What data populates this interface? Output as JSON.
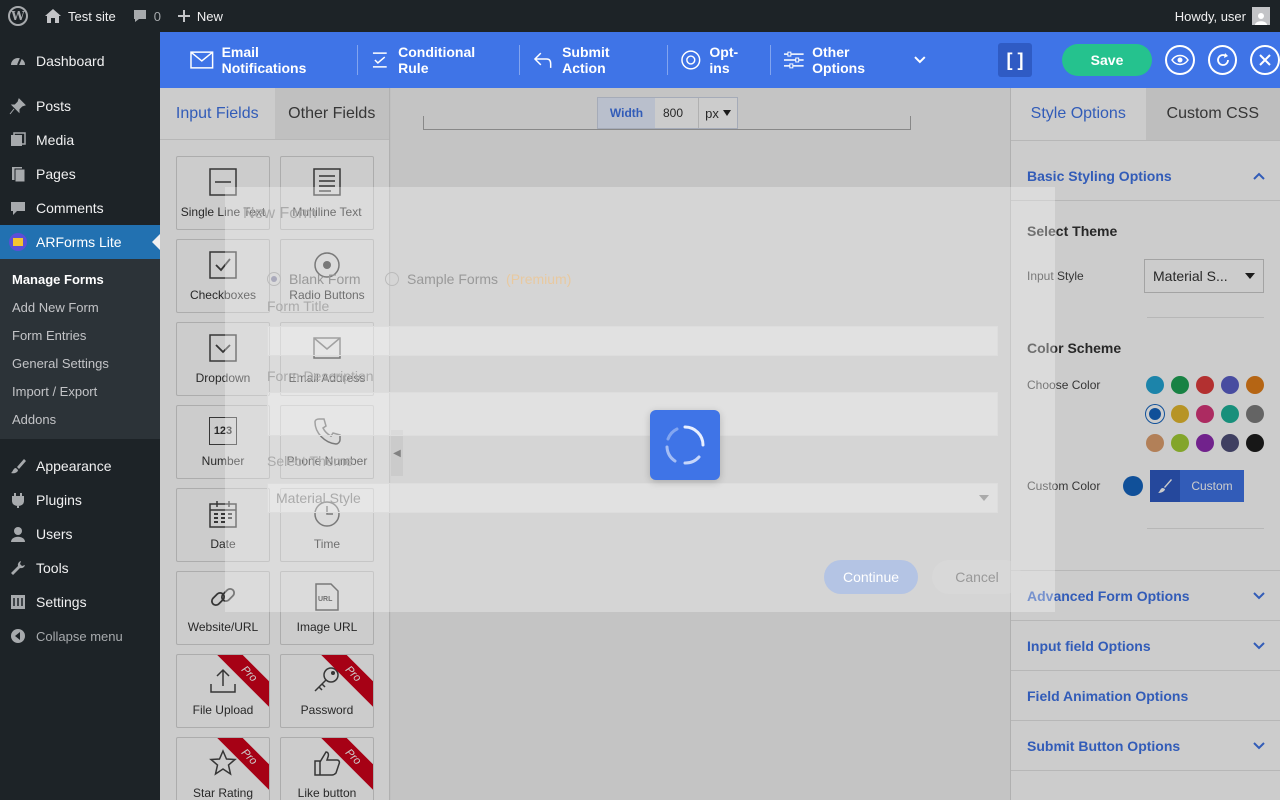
{
  "admin_bar": {
    "site_name": "Test site",
    "comments_count": "0",
    "new_label": "New",
    "howdy": "Howdy, user"
  },
  "sidebar": {
    "items": [
      {
        "label": "Dashboard",
        "icon": "dashboard-icon"
      },
      {
        "label": "Posts",
        "icon": "pin-icon"
      },
      {
        "label": "Media",
        "icon": "media-icon"
      },
      {
        "label": "Pages",
        "icon": "pages-icon"
      },
      {
        "label": "Comments",
        "icon": "comment-icon"
      },
      {
        "label": "ARForms Lite",
        "icon": "arforms-icon"
      }
    ],
    "submenu": [
      "Manage Forms",
      "Add New Form",
      "Form Entries",
      "General Settings",
      "Import / Export",
      "Addons"
    ],
    "items2": [
      {
        "label": "Appearance",
        "icon": "brush-icon"
      },
      {
        "label": "Plugins",
        "icon": "plugin-icon"
      },
      {
        "label": "Users",
        "icon": "user-icon"
      },
      {
        "label": "Tools",
        "icon": "wrench-icon"
      },
      {
        "label": "Settings",
        "icon": "settings-icon"
      }
    ],
    "collapse": "Collapse menu"
  },
  "toolbar": {
    "email": "Email Notifications",
    "conditional": "Conditional Rule",
    "submit": "Submit Action",
    "optins": "Opt-ins",
    "other": "Other Options",
    "save": "Save"
  },
  "left_panel": {
    "tabs": [
      "Input Fields",
      "Other Fields"
    ],
    "fields": [
      {
        "label": "Single Line Text",
        "icon": "single-line-icon",
        "pro": false
      },
      {
        "label": "Multiline Text",
        "icon": "multiline-icon",
        "pro": false
      },
      {
        "label": "Checkboxes",
        "icon": "checkbox-icon",
        "pro": false
      },
      {
        "label": "Radio Buttons",
        "icon": "radio-icon",
        "pro": false
      },
      {
        "label": "Dropdown",
        "icon": "dropdown-icon",
        "pro": false
      },
      {
        "label": "Email Address",
        "icon": "email-icon",
        "pro": false
      },
      {
        "label": "Number",
        "icon": "number-icon",
        "pro": false
      },
      {
        "label": "Phone Number",
        "icon": "phone-icon",
        "pro": false
      },
      {
        "label": "Date",
        "icon": "calendar-icon",
        "pro": false
      },
      {
        "label": "Time",
        "icon": "clock-icon",
        "pro": false
      },
      {
        "label": "Website/URL",
        "icon": "link-icon",
        "pro": false
      },
      {
        "label": "Image URL",
        "icon": "image-url-icon",
        "pro": false
      },
      {
        "label": "File Upload",
        "icon": "upload-icon",
        "pro": true
      },
      {
        "label": "Password",
        "icon": "key-icon",
        "pro": true
      },
      {
        "label": "Star Rating",
        "icon": "star-icon",
        "pro": true
      },
      {
        "label": "Like button",
        "icon": "thumb-icon",
        "pro": true
      }
    ],
    "pro_label": "Pro",
    "number_glyph": "123",
    "url_glyph": "URL"
  },
  "canvas": {
    "width_label": "Width",
    "width_value": "800",
    "unit": "px"
  },
  "modal": {
    "title": "New Form",
    "option_blank": "Blank Form",
    "option_sample": "Sample Forms",
    "premium": "(Premium)",
    "form_title_label": "Form Title",
    "form_desc_label": "Form Description",
    "theme_label": "Select Theme",
    "theme_value": "Material Style",
    "continue": "Continue",
    "cancel": "Cancel"
  },
  "right_panel": {
    "tabs": [
      "Style Options",
      "Custom CSS"
    ],
    "basic_heading": "Basic Styling Options",
    "select_theme": "Select Theme",
    "input_style_label": "Input Style",
    "input_style_value": "Material S...",
    "color_scheme": "Color Scheme",
    "choose_color": "Choose Color",
    "custom_color": "Custom Color",
    "custom_btn": "Custom",
    "swatches": [
      "#23a6d5",
      "#1fa355",
      "#e03c3c",
      "#5a5fc8",
      "#e37f1a",
      "#1565c0",
      "#e5ba2f",
      "#d8367a",
      "#1fb39a",
      "#7d7d7d",
      "#dfa06f",
      "#a4cf35",
      "#8e2bb0",
      "#4f4f7a",
      "#1d1d1d"
    ],
    "accordions": [
      "Advanced Form Options",
      "Input field Options",
      "Field Animation Options",
      "Submit Button Options"
    ]
  },
  "colors": {
    "accent": "#3f74e7",
    "save_green": "#25c28e",
    "wp_dark": "#1d2327",
    "wp_blue": "#2271b1"
  }
}
